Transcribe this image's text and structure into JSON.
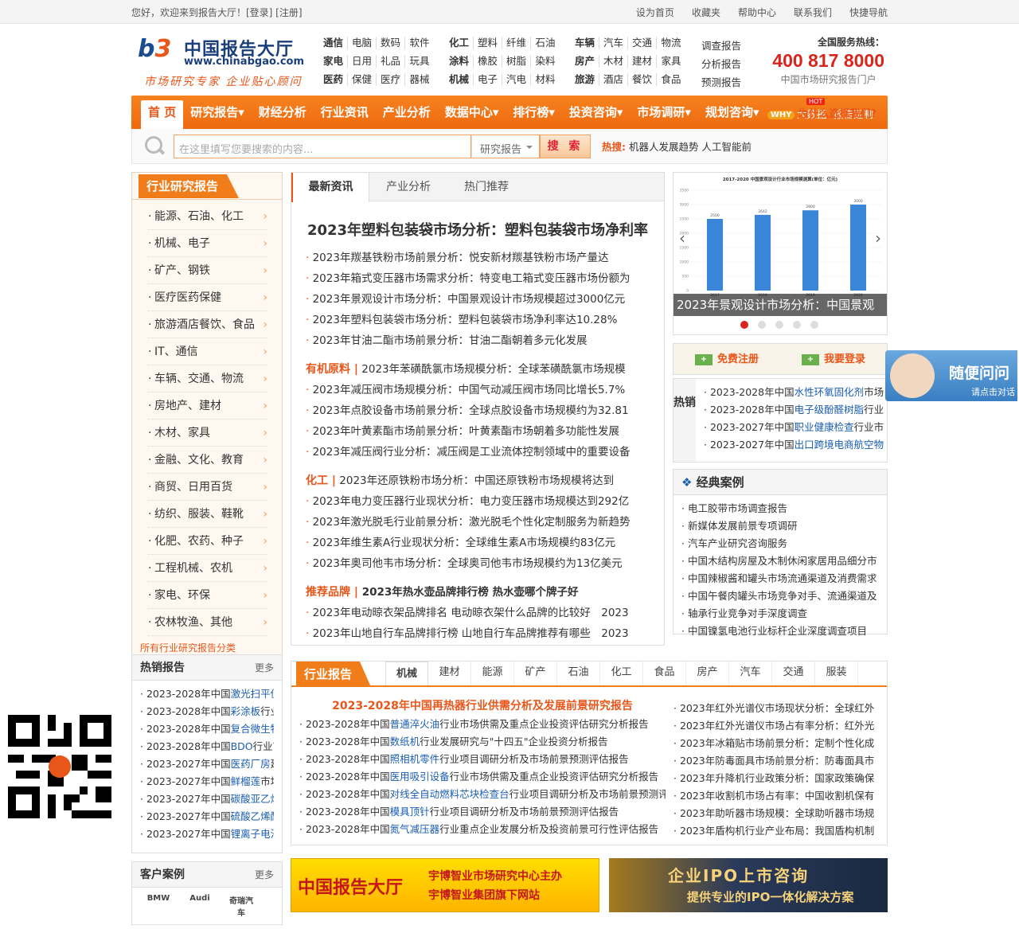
{
  "topbar": {
    "welcome": "您好，欢迎来到报告大厅！[登录] [注册]",
    "links": [
      "设为首页",
      "收藏夹",
      "帮助中心",
      "联系我们",
      "快捷导航"
    ]
  },
  "logo": {
    "mark_a": "b",
    "mark_b": "3",
    "name": "中国报告大厅",
    "url": "www.chinabgao.com",
    "slogan": "市场研究专家 企业贴心顾问"
  },
  "catgroups": [
    [
      {
        "t": "通信",
        "b": true
      },
      {
        "t": "电脑"
      },
      {
        "t": "数码"
      },
      {
        "t": "软件"
      },
      {
        "t": "家电",
        "b": true
      },
      {
        "t": "日用"
      },
      {
        "t": "礼品"
      },
      {
        "t": "玩具"
      },
      {
        "t": "医药",
        "b": true
      },
      {
        "t": "保健"
      },
      {
        "t": "医疗"
      },
      {
        "t": "器械"
      }
    ],
    [
      {
        "t": "化工",
        "b": true
      },
      {
        "t": "塑料"
      },
      {
        "t": "纤维"
      },
      {
        "t": "石油"
      },
      {
        "t": "涂料",
        "b": true
      },
      {
        "t": "橡胶"
      },
      {
        "t": "树脂"
      },
      {
        "t": "染料"
      },
      {
        "t": "机械",
        "b": true
      },
      {
        "t": "电子"
      },
      {
        "t": "汽电"
      },
      {
        "t": "材料"
      }
    ],
    [
      {
        "t": "车辆",
        "b": true
      },
      {
        "t": "汽车"
      },
      {
        "t": "交通"
      },
      {
        "t": "物流"
      },
      {
        "t": "房产",
        "b": true
      },
      {
        "t": "木材"
      },
      {
        "t": "建材"
      },
      {
        "t": "家具"
      },
      {
        "t": "旅游",
        "b": true
      },
      {
        "t": "酒店"
      },
      {
        "t": "餐饮"
      },
      {
        "t": "食品"
      }
    ]
  ],
  "reportlinks": [
    "调查报告",
    "分析报告",
    "预测报告"
  ],
  "hotline": {
    "title": "全国服务热线：",
    "number": "400 817 8000",
    "sub": "中国市场研究报告门户"
  },
  "nav": {
    "items": [
      "首 页",
      "研究报告▾",
      "财经分析",
      "行业资讯",
      "产业分析",
      "数据中心▾",
      "排行榜▾",
      "投资咨询▾",
      "市场调研▾",
      "规划咨询▾"
    ],
    "small": [
      "大数据",
      "报告定制"
    ],
    "hot": "HOT"
  },
  "search": {
    "placeholder": "在这里填写您要搜索的内容...",
    "select": "研究报告",
    "button": "搜 索",
    "hot_label": "热搜:",
    "hot_words": "机器人发展趋势  人工智能前",
    "why_badge": "WHY",
    "why": "为什么选择我们?"
  },
  "categories": {
    "title": "行业研究报告",
    "items": [
      "能源、石油、化工",
      "机械、电子",
      "矿产、钢铁",
      "医疗医药保健",
      "旅游酒店餐饮、食品",
      "IT、通信",
      "车辆、交通、物流",
      "房地产、建材",
      "木材、家具",
      "金融、文化、教育",
      "商贸、日用百货",
      "纺织、服装、鞋靴",
      "化肥、农药、种子",
      "工程机械、农机",
      "家电、环保",
      "农林牧渔、其他"
    ],
    "all": "所有行业研究报告分类"
  },
  "hotreports": {
    "title": "热销报告",
    "more": "更多",
    "items": [
      {
        "pre": "2023-2028年中国",
        "hl": "激光扫平仪",
        "post": ""
      },
      {
        "pre": "2023-2028年中国",
        "hl": "彩涂板",
        "post": "行业"
      },
      {
        "pre": "2023-2028年中国",
        "hl": "复合微生物",
        "post": ""
      },
      {
        "pre": "2023-2028年中国",
        "hl": "BDO",
        "post": "行业市"
      },
      {
        "pre": "2023-2027年中国",
        "hl": "医药厂房",
        "post": "建"
      },
      {
        "pre": "2023-2027年中国",
        "hl": "鲜榴莲",
        "post": "市场"
      },
      {
        "pre": "2023-2027年中国",
        "hl": "碳酸亚乙烯",
        "post": ""
      },
      {
        "pre": "2023-2027年中国",
        "hl": "硫酸乙烯酯",
        "post": ""
      },
      {
        "pre": "2023-2027年中国",
        "hl": "锂离子电池",
        "post": ""
      }
    ]
  },
  "clientcases": {
    "title": "客户案例",
    "more": "更多",
    "logos": [
      "BMW",
      "Audi",
      "奇瑞汽车"
    ]
  },
  "center": {
    "tabs": [
      "最新资讯",
      "产业分析",
      "热门推荐"
    ],
    "headline": "2023年塑料包装袋市场分析：塑料包装袋市场净利率",
    "news": [
      "2023年羰基铁粉市场前景分析：悦安新材羰基铁粉市场产量达",
      "2023年箱式变压器市场需求分析：特变电工箱式变压器市场份额为",
      "2023年景观设计市场分析：中国景观设计市场规模超过3000亿元",
      "2023年塑料包装袋市场分析：塑料包装袋市场净利率达10.28%",
      "2023年甘油二酯市场前景分析：甘油二酯朝着多元化发展"
    ],
    "sec1": {
      "tag": "有机原料 |",
      "first": " 2023年苯磺酰氯市场规模分析：全球苯磺酰氯市场规模",
      "items": [
        "2023年减压阀市场规模分析：中国气动减压阀市场同比增长5.7%",
        "2023年点胶设备市场前景分析：全球点胶设备市场规模约为32.81",
        "2023年叶黄素酯市场前景分析：叶黄素酯市场朝着多功能性发展",
        "2023年减压阀行业分析：减压阀是工业流体控制领域中的重要设备"
      ]
    },
    "sec2": {
      "tag": "化工 |",
      "first": " 2023年还原铁粉市场分析：中国还原铁粉市场规模将达到",
      "items": [
        "2023年电力变压器行业现状分析：电力变压器市场规模达到292亿",
        "2023年激光脱毛行业前景分析：激光脱毛个性化定制服务为新趋势",
        "2023年维生素A行业现状分析：全球维生素A市场规模约83亿元",
        "2023年奥司他韦市场分析：全球奥司他韦市场规模约为13亿美元"
      ]
    },
    "sec3": {
      "tag": "推荐品牌 |",
      "first": " 2023年热水壶品牌排行榜 热水壶哪个牌子好",
      "items": [
        "2023年电动晾衣架品牌排名 电动晾衣架什么品牌的比较好　2023",
        "2023年山地自行车品牌排行榜 山地自行车品牌推荐有哪些　2023"
      ]
    }
  },
  "slider": {
    "caption": "2023年景观设计市场分析：中国景观",
    "chart_title": "2017-2020 中国景观设计行业市场规模测算(单位：亿元)",
    "x": [
      "2017",
      "2018",
      "2019",
      "2020"
    ],
    "values": [
      2500,
      2642,
      2800,
      3000
    ],
    "yticks": [
      "3500",
      "3000",
      "2500",
      "2000",
      "1500",
      "1000",
      "500",
      "0"
    ],
    "ylim": [
      0,
      3500
    ]
  },
  "account": {
    "register": "免费注册",
    "login": "我要登录"
  },
  "hotsale": {
    "title": "热销",
    "items": [
      {
        "pre": "2023-2028年中国",
        "hl": "水性环氧固化剂",
        "post": "市场"
      },
      {
        "pre": "2023-2028年中国",
        "hl": "电子级酚醛树脂",
        "post": "行业"
      },
      {
        "pre": "2023-2027年中国",
        "hl": "职业健康检查",
        "post": "行业市"
      },
      {
        "pre": "2023-2027年中国",
        "hl": "出口跨境电商航空物",
        "post": ""
      }
    ]
  },
  "cases": {
    "title": "经典案例",
    "items": [
      "电工胶带市场调查报告",
      "新媒体发展前景专项调研",
      "汽车产业研究咨询服务",
      "中国木结构房屋及木制休闲家居用品细分市",
      "中国辣椒酱和罐头市场流通渠道及消费需求",
      "中国午餐肉罐头市场竞争对手、流通渠道及",
      "轴承行业竞争对手深度调查",
      "中国镍氢电池行业标杆企业深度调查项目"
    ]
  },
  "industry": {
    "label": "行业报告",
    "tabs": [
      "机械",
      "建材",
      "能源",
      "矿产",
      "石油",
      "化工",
      "食品",
      "房产",
      "汽车",
      "交通",
      "服装"
    ],
    "headline": "2023-2028年中国再热器行业供需分析及发展前景研究报告",
    "left": [
      {
        "pre": "2023-2028年中国",
        "hl": "普通淬火油",
        "post": "行业市场供需及重点企业投资评估研究分析报告"
      },
      {
        "pre": "2023-2028年中国",
        "hl": "数纸机",
        "post": "行业发展研究与\"十四五\"企业投资分析报告"
      },
      {
        "pre": "2023-2028年中国",
        "hl": "照相机零件",
        "post": "行业项目调研分析及市场前景预测评估报告"
      },
      {
        "pre": "2023-2028年中国",
        "hl": "医用吸引设备",
        "post": "行业市场供需及重点企业投资评估研究分析报告"
      },
      {
        "pre": "2023-2028年中国",
        "hl": "对线全自动燃料芯块检查台",
        "post": "行业项目调研分析及市场前景预测评"
      },
      {
        "pre": "2023-2028年中国",
        "hl": "模具顶针",
        "post": "行业项目调研分析及市场前景预测评估报告"
      },
      {
        "pre": "2023-2028年中国",
        "hl": "氮气减压器",
        "post": "行业重点企业发展分析及投资前景可行性评估报告"
      }
    ],
    "right": [
      "2023年红外光谱仪市场现状分析：全球红外",
      "2023年红外光谱仪市场占有率分析：红外光",
      "2023年冰箱贴市场前景分析：定制个性化成",
      "2023年防毒面具市场前景分析：防毒面具市",
      "2023年升降机行业政策分析：国家政策确保",
      "2023年收割机市场占有率：中国收割机保有",
      "2023年助听器市场规模：全球助听器市场规",
      "2023年盾构机行业产业布局：我国盾构机制"
    ]
  },
  "banners": {
    "b1_title": "中国报告大厅",
    "b1_line1": "宇博智业市场研究中心主办",
    "b1_line2": "宇博智业集团旗下网站",
    "b2_title": "企业IPO上市咨询",
    "b2_sub": "提供专业的IPO一体化解决方案"
  },
  "chat": {
    "title": "随便问问",
    "sub": "请点击对话"
  },
  "colors": {
    "accent": "#f07c1a",
    "hotline": "#d9261c",
    "link": "#1a5db0"
  }
}
